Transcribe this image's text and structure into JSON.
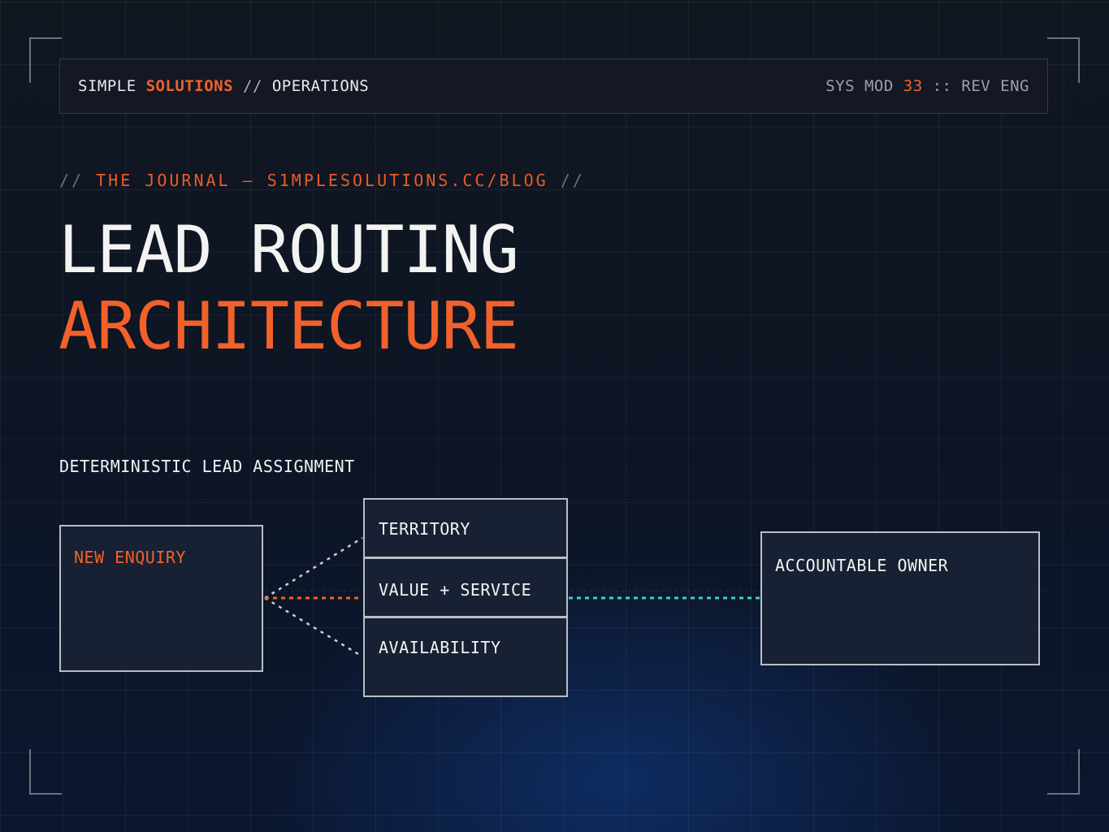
{
  "header": {
    "brand_part1": "SIMPLE",
    "brand_part2": "SOLUTIONS",
    "brand_sep": "//",
    "brand_part3": "OPERATIONS",
    "sys_prefix": "SYS MOD",
    "sys_number": "33",
    "sys_suffix": ":: REV ENG"
  },
  "kicker": {
    "open": "//",
    "text": "THE JOURNAL — S1MPLESOLUTIONS.CC/BLOG",
    "close": "//"
  },
  "title": {
    "line1": "LEAD ROUTING",
    "line2": "ARCHITECTURE"
  },
  "diagram": {
    "label": "DETERMINISTIC LEAD ASSIGNMENT",
    "source": "NEW ENQUIRY",
    "rules": [
      "TERRITORY",
      "VALUE + SERVICE",
      "AVAILABILITY"
    ],
    "target": "ACCOUNTABLE OWNER",
    "colors": {
      "accent": "#f2612a",
      "output_link": "#3fd3b5",
      "branch_link": "#c9ced6"
    }
  }
}
